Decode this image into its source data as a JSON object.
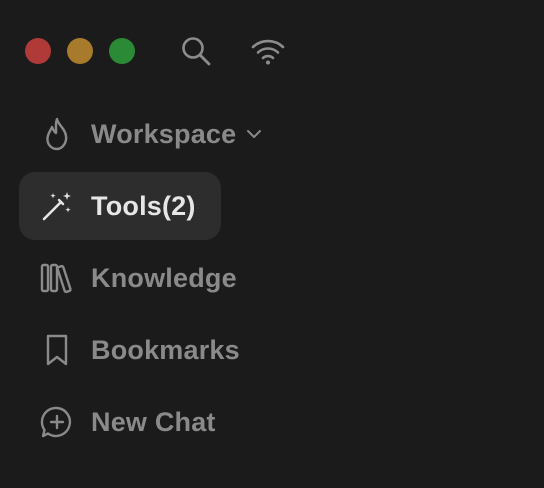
{
  "window": {
    "traffic_lights": [
      "close",
      "minimize",
      "zoom"
    ],
    "toolbar_icons": [
      "search-icon",
      "wifi-icon"
    ]
  },
  "nav": {
    "items": [
      {
        "label": "Workspace",
        "icon": "flame-icon",
        "has_dropdown": true
      },
      {
        "label": "Tools(2)",
        "icon": "magic-wand-icon",
        "active": true
      },
      {
        "label": "Knowledge",
        "icon": "library-books-icon"
      },
      {
        "label": "Bookmarks",
        "icon": "bookmark-icon"
      },
      {
        "label": "New Chat",
        "icon": "chat-plus-icon"
      }
    ]
  },
  "colors": {
    "background": "#1b1b1b",
    "active_item_bg": "#2d2d2d",
    "label_inactive": "#8a8a8a",
    "label_active": "#e6e6e6",
    "traffic_red": "#b03a37",
    "traffic_yellow": "#a87a2c",
    "traffic_green": "#2a8a35"
  }
}
